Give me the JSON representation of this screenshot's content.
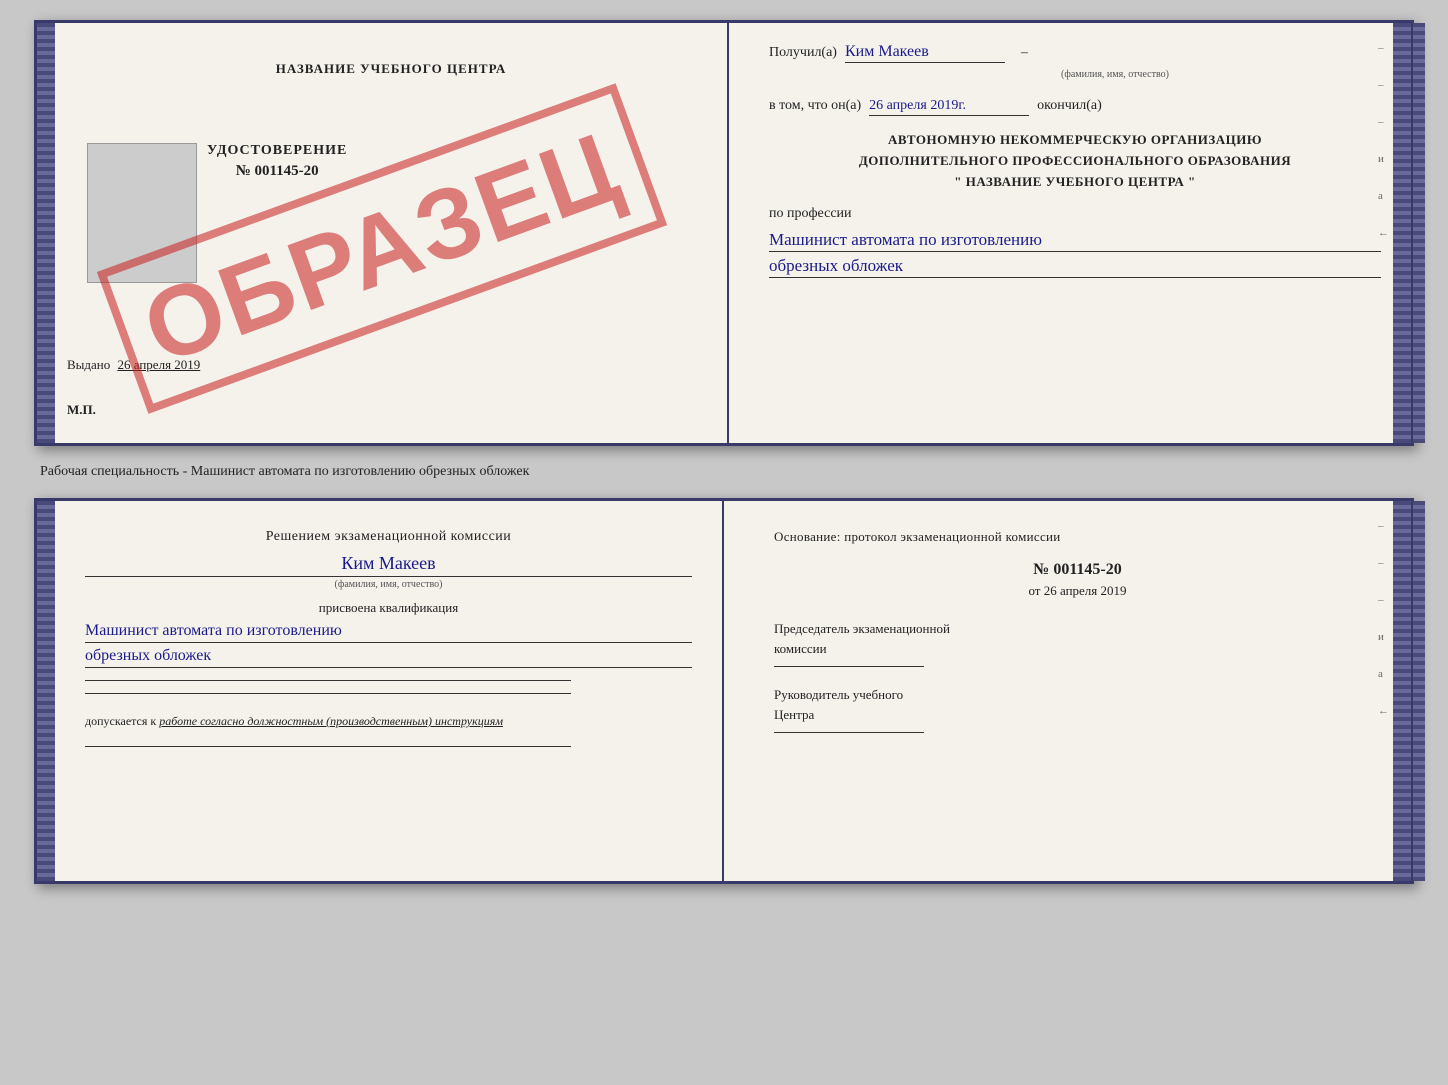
{
  "top_doc": {
    "left": {
      "title": "НАЗВАНИЕ УЧЕБНОГО ЦЕНТРА",
      "stamp_text": "ОБРАЗЕЦ",
      "udostoverenie": "УДОСТОВЕРЕНИЕ",
      "number": "№ 001145-20",
      "vydano_label": "Выдано",
      "vydano_date": "26 апреля 2019",
      "mp_label": "М.П."
    },
    "right": {
      "poluchil_label": "Получил(а)",
      "recipient_name": "Ким Макеев",
      "fio_label": "(фамилия, имя, отчество)",
      "v_tom_label": "в том, что он(а)",
      "completion_date": "26 апреля 2019г.",
      "okonchil_label": "окончил(а)",
      "org_line1": "АВТОНОМНУЮ НЕКОММЕРЧЕСКУЮ ОРГАНИЗАЦИЮ",
      "org_line2": "ДОПОЛНИТЕЛЬНОГО ПРОФЕССИОНАЛЬНОГО ОБРАЗОВАНИЯ",
      "org_line3": "\"   НАЗВАНИЕ УЧЕБНОГО ЦЕНТРА   \"",
      "po_professii_label": "по профессии",
      "profession_line1": "Машинист автомата по изготовлению",
      "profession_line2": "обрезных обложек",
      "dashes": [
        "-",
        "-",
        "-",
        "и",
        "а",
        "←"
      ]
    }
  },
  "separator": {
    "text": "Рабочая специальность - Машинист автомата по изготовлению обрезных обложек"
  },
  "bottom_doc": {
    "left": {
      "resheniem_text": "Решением экзаменационной комиссии",
      "fio": "Ким Макеев",
      "fio_label": "(фамилия, имя, отчество)",
      "prisvoena_label": "присвоена квалификация",
      "qual_line1": "Машинист автомата по изготовлению",
      "qual_line2": "обрезных обложек",
      "dopuskaetsya_prefix": "допускается к",
      "dopuskaetsya_text": "работе согласно должностным (производственным) инструкциям"
    },
    "right": {
      "osnovanie_text": "Основание: протокол экзаменационной комиссии",
      "number_label": "№",
      "number_value": "001145-20",
      "ot_label": "от",
      "date_value": "26 апреля 2019",
      "predsedatel_line1": "Председатель экзаменационной",
      "predsedatel_line2": "комиссии",
      "rukovoditel_line1": "Руководитель учебного",
      "rukovoditel_line2": "Центра",
      "dashes": [
        "-",
        "-",
        "-",
        "и",
        "а",
        "←"
      ]
    }
  }
}
